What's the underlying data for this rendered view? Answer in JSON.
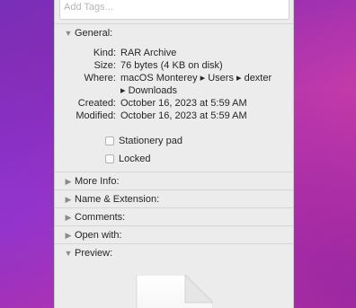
{
  "tags": {
    "placeholder": "Add Tags..."
  },
  "general": {
    "header": "General:",
    "rows": [
      {
        "key": "Kind:",
        "value": "RAR Archive"
      },
      {
        "key": "Size:",
        "value": "76 bytes (4 KB on disk)"
      },
      {
        "key": "Where:",
        "value": "macOS Monterey ▸ Users ▸ dexter"
      },
      {
        "key": "",
        "value": "▸ Downloads"
      },
      {
        "key": "Created:",
        "value": "October 16, 2023 at 5:59 AM"
      },
      {
        "key": "Modified:",
        "value": "October 16, 2023 at 5:59 AM"
      }
    ],
    "stationery_label": "Stationery pad",
    "locked_label": "Locked"
  },
  "sections": {
    "more_info": "More Info:",
    "name_extension": "Name & Extension:",
    "comments": "Comments:",
    "open_with": "Open with:",
    "preview": "Preview:"
  },
  "icons": {
    "expanded": "chevron-down-icon",
    "collapsed": "chevron-right-icon",
    "preview": "document-icon"
  },
  "colors": {
    "window_bg": "#ececec",
    "text": "#262626",
    "wallpaper_start": "#7a2fb8",
    "wallpaper_end": "#c9359a"
  }
}
